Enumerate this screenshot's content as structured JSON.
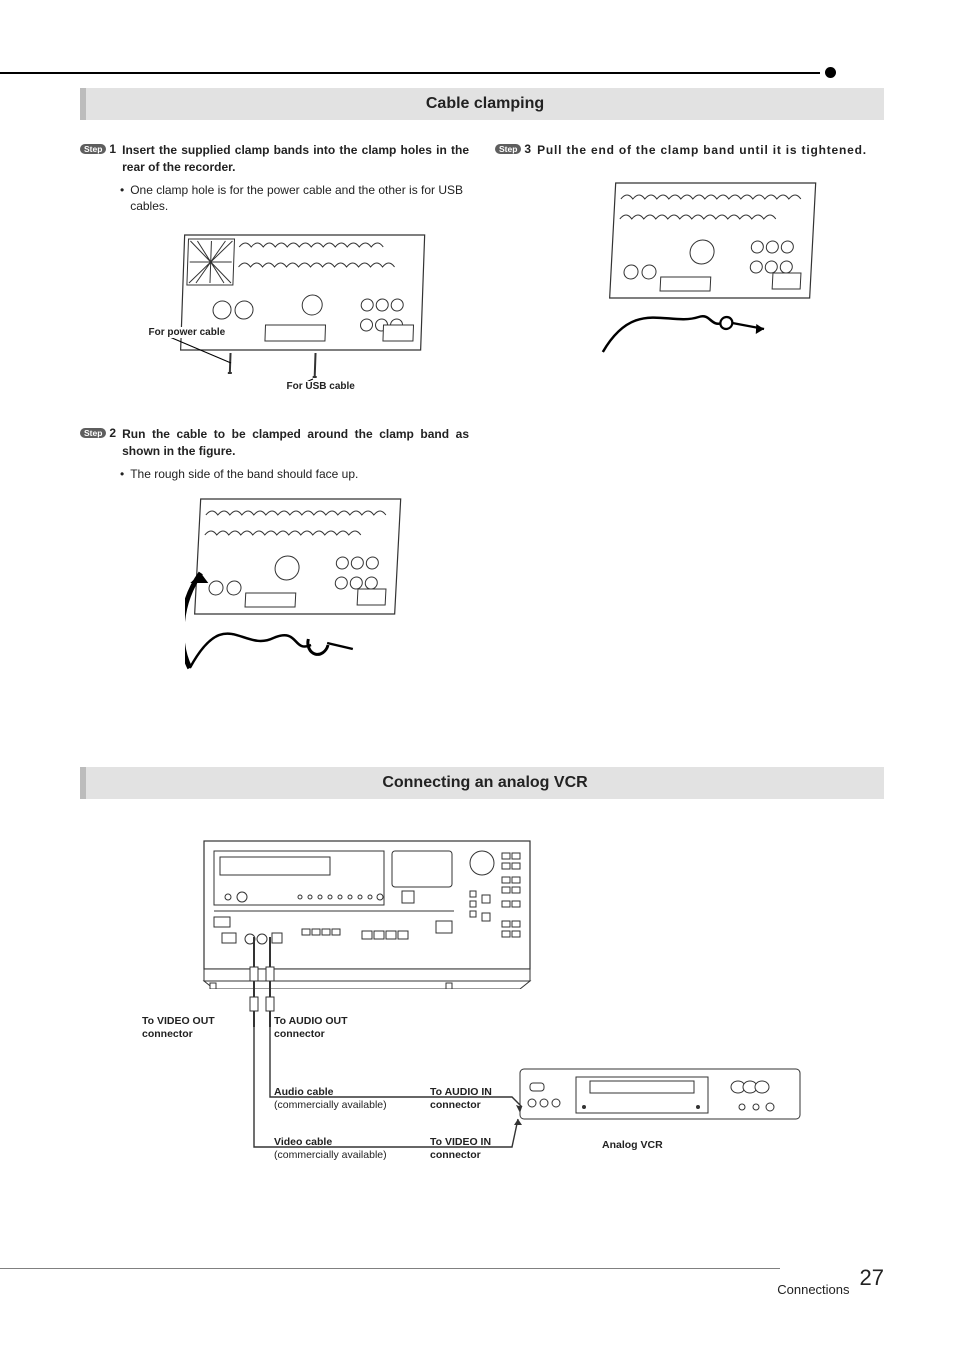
{
  "sections": {
    "banner1": "Cable clamping",
    "banner2": "Connecting an analog VCR"
  },
  "steps": {
    "pill": "Step",
    "s1": {
      "num": "1",
      "title": "Insert the supplied clamp bands into the clamp holes in the rear of the recorder.",
      "body": "One clamp hole is for the power cable and the other is for USB cables.",
      "label_power": "For power cable",
      "label_usb": "For USB cable"
    },
    "s2": {
      "num": "2",
      "title": "Run the cable to be clamped around the clamp band as shown in the figure.",
      "body": "The rough side of the band should face up."
    },
    "s3": {
      "num": "3",
      "title": "Pull the end of the clamp band until it is tightened."
    }
  },
  "vcr": {
    "to_video_out": "To VIDEO OUT connector",
    "to_audio_out": "To AUDIO OUT connector",
    "audio_cable": "Audio cable",
    "comm_avail": "(commercially available)",
    "to_audio_in": "To AUDIO IN connector",
    "video_cable": "Video cable",
    "to_video_in": "To VIDEO IN connector",
    "analog_vcr": "Analog VCR"
  },
  "footer": {
    "section": "Connections",
    "page": "27"
  }
}
